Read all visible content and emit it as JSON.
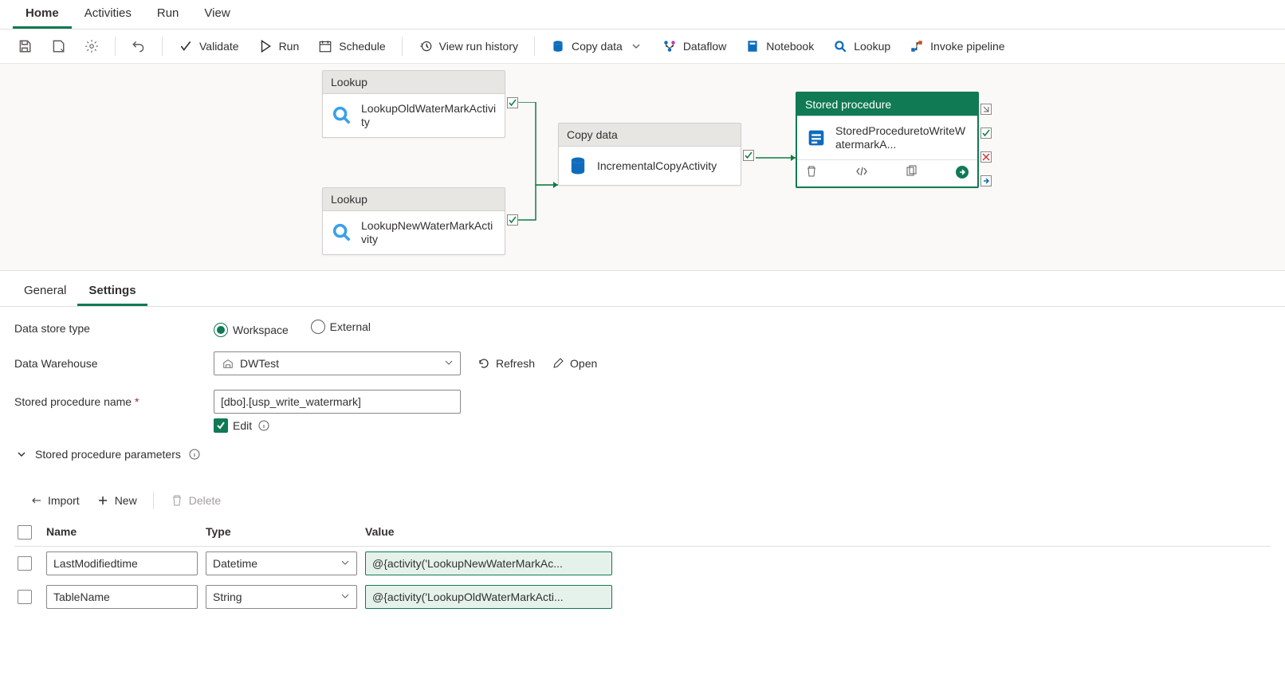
{
  "topTabs": [
    "Home",
    "Activities",
    "Run",
    "View"
  ],
  "topTabActive": 0,
  "toolbar": {
    "validate": "Validate",
    "run": "Run",
    "schedule": "Schedule",
    "viewRunHistory": "View run history",
    "copyData": "Copy data",
    "dataflow": "Dataflow",
    "notebook": "Notebook",
    "lookup": "Lookup",
    "invokePipeline": "Invoke pipeline"
  },
  "nodes": {
    "lookup1": {
      "type": "Lookup",
      "name": "LookupOldWaterMarkActivity"
    },
    "lookup2": {
      "type": "Lookup",
      "name": "LookupNewWaterMarkActivity"
    },
    "copy": {
      "type": "Copy data",
      "name": "IncrementalCopyActivity"
    },
    "sp": {
      "type": "Stored procedure",
      "name": "StoredProceduretoWriteWatermarkA..."
    }
  },
  "panel": {
    "tabs": [
      "General",
      "Settings"
    ],
    "activeTab": 1,
    "dataStoreTypeLabel": "Data store type",
    "workspace": "Workspace",
    "external": "External",
    "dataWarehouseLabel": "Data Warehouse",
    "dataWarehouseValue": "DWTest",
    "refresh": "Refresh",
    "open": "Open",
    "spNameLabel": "Stored procedure name",
    "spNameValue": "[dbo].[usp_write_watermark]",
    "edit": "Edit",
    "spParamsTitle": "Stored procedure parameters",
    "import": "Import",
    "new": "New",
    "delete": "Delete",
    "columns": {
      "name": "Name",
      "type": "Type",
      "value": "Value"
    },
    "params": [
      {
        "name": "LastModifiedtime",
        "type": "Datetime",
        "value": "@{activity('LookupNewWaterMarkAc..."
      },
      {
        "name": "TableName",
        "type": "String",
        "value": "@{activity('LookupOldWaterMarkActi..."
      }
    ]
  }
}
